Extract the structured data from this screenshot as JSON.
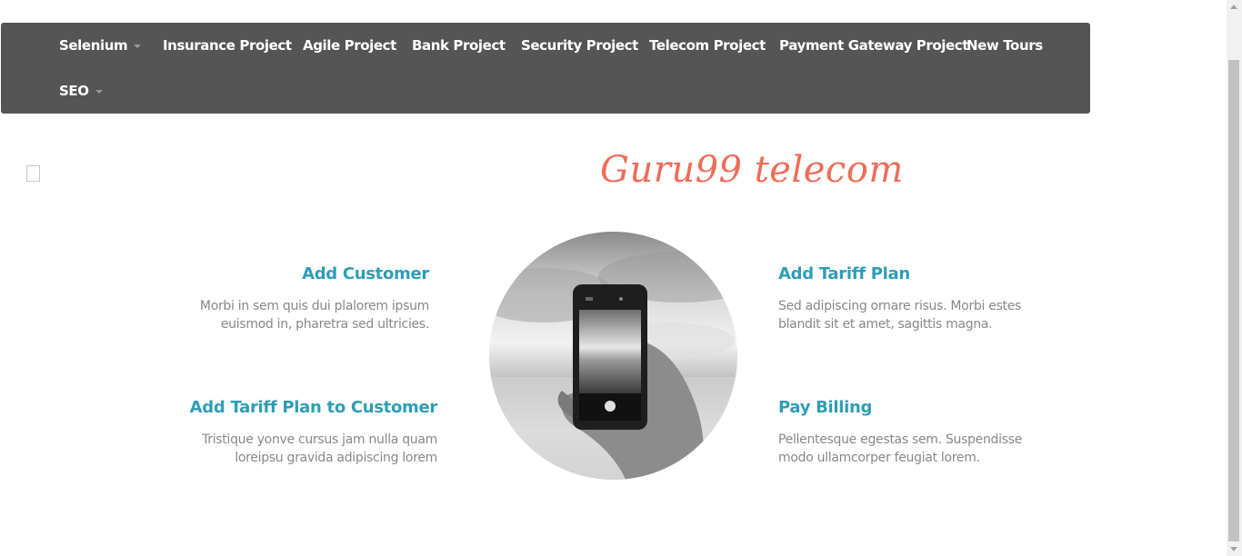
{
  "nav": {
    "items": [
      {
        "label": "Selenium",
        "dropdown": true
      },
      {
        "label": "Insurance Project"
      },
      {
        "label": "Agile Project"
      },
      {
        "label": "Bank Project"
      },
      {
        "label": "Security Project"
      },
      {
        "label": "Telecom Project"
      },
      {
        "label": "Payment Gateway Project"
      },
      {
        "label": "New Tours"
      },
      {
        "label": "SEO",
        "dropdown": true
      }
    ]
  },
  "brand": {
    "title": "Guru99 telecom",
    "color": "#ef6c58"
  },
  "features": [
    {
      "title": "Add Customer",
      "text": "Morbi in sem quis dui plalorem ipsum euismod in, pharetra sed ultricies."
    },
    {
      "title": "Add Tariff Plan to Customer",
      "text": "Tristique yonve cursus jam nulla quam loreipsu gravida adipiscing lorem"
    },
    {
      "title": "Add Tariff Plan",
      "text": "Sed adipiscing ornare risus. Morbi estes blandit sit et amet, sagittis magna."
    },
    {
      "title": "Pay Billing",
      "text": "Pellentesque egestas sem. Suspendisse modo ullamcorper feugiat lorem."
    }
  ],
  "photo": {
    "icon": "hand-holding-phone-photo"
  },
  "colors": {
    "navbar": "#555555",
    "accent": "#2e9db6",
    "brand": "#ef6c58"
  }
}
